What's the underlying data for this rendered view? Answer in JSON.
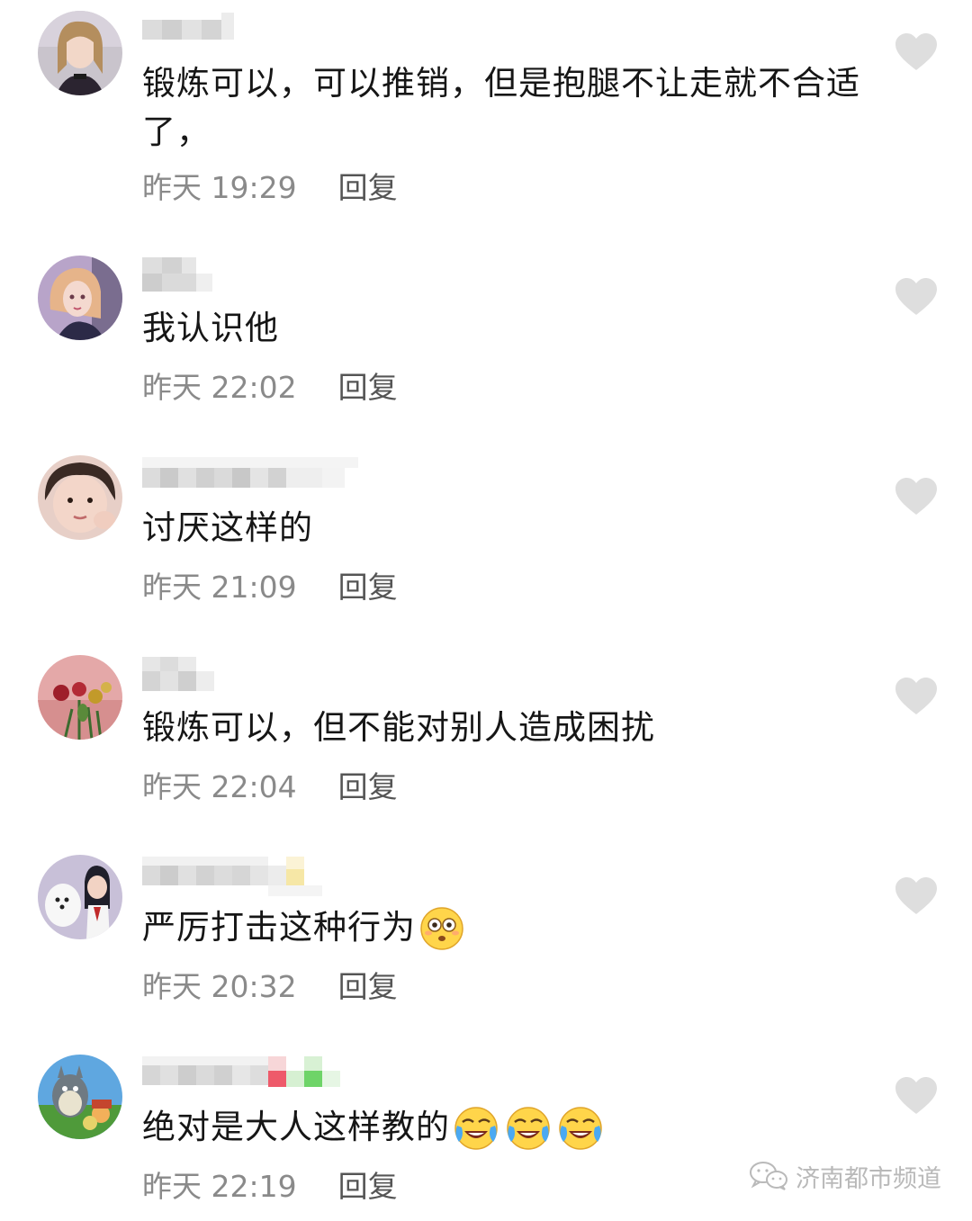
{
  "comments": [
    {
      "text": "锻炼可以，可以推销，但是抱腿不让走就不合适了，",
      "time": "昨天 19:29",
      "reply": "回复",
      "emojis": []
    },
    {
      "text": "我认识他",
      "time": "昨天 22:02",
      "reply": "回复",
      "emojis": []
    },
    {
      "text": "讨厌这样的",
      "time": "昨天 21:09",
      "reply": "回复",
      "emojis": []
    },
    {
      "text": "锻炼可以，但不能对别人造成困扰",
      "time": "昨天 22:04",
      "reply": "回复",
      "emojis": []
    },
    {
      "text": "严厉打击这种行为",
      "time": "昨天 20:32",
      "reply": "回复",
      "emojis": [
        "dizzy-face-emoji"
      ]
    },
    {
      "text": "绝对是大人这样教的",
      "time": "昨天 22:19",
      "reply": "回复",
      "emojis": [
        "crying-laughing-emoji",
        "crying-laughing-emoji",
        "crying-laughing-emoji"
      ]
    }
  ],
  "icons": {
    "like": "heart-icon",
    "watermark": "wechat-icon"
  },
  "colors": {
    "like_heart": "#dedede",
    "meta_text": "#8a8a8a",
    "reply_text": "#555555",
    "watermark": "#b9b9b9"
  },
  "watermark": {
    "text": "济南都市频道"
  }
}
